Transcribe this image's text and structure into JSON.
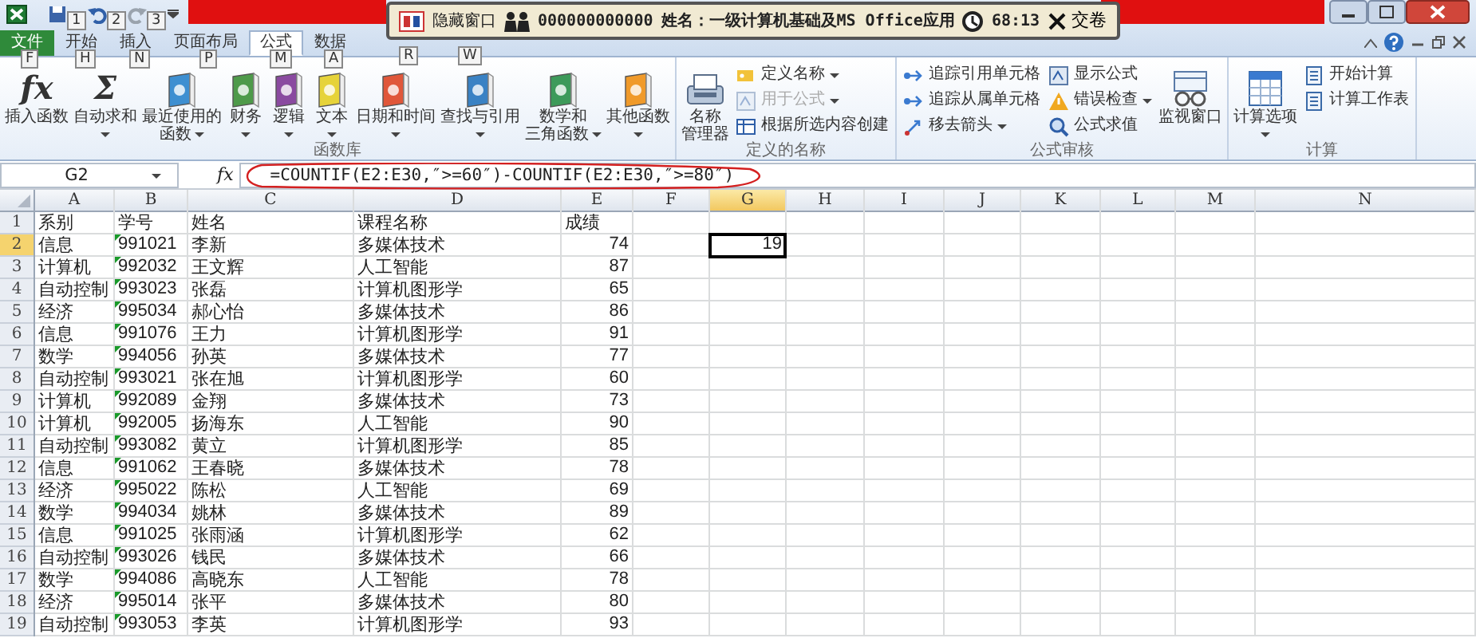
{
  "quick_access": {
    "keytips": [
      "1",
      "2",
      "3"
    ]
  },
  "exam_bar": {
    "hide_button": "隐藏窗口",
    "exam_id": "000000000000",
    "candidate": "姓名：一级计算机基础及MS Office应用",
    "timer": "68:13",
    "submit_button": "交卷"
  },
  "tabs": [
    {
      "label": "文件",
      "keytip": "F",
      "kind": "file",
      "selected": false
    },
    {
      "label": "开始",
      "keytip": "H",
      "kind": "tab",
      "selected": false
    },
    {
      "label": "插入",
      "keytip": "N",
      "kind": "tab",
      "selected": false
    },
    {
      "label": "页面布局",
      "keytip": "P",
      "kind": "tab",
      "selected": false
    },
    {
      "label": "公式",
      "keytip": "M",
      "kind": "tab",
      "selected": true
    },
    {
      "label": "数据",
      "keytip": "A",
      "kind": "tab",
      "selected": false
    }
  ],
  "hidden_tab_keytips": [
    "R",
    "W"
  ],
  "ribbon_groups": [
    {
      "label": "函数库",
      "items": [
        {
          "kind": "glyph",
          "glyph": "fx",
          "lines": [
            "插入函数"
          ],
          "dropdown": false
        },
        {
          "kind": "glyph",
          "glyph": "Σ",
          "lines": [
            "自动求和"
          ],
          "dropdown": true
        },
        {
          "kind": "book",
          "color": "#3d8fd1",
          "lines": [
            "最近使用的",
            "函数"
          ],
          "dropdown": true
        },
        {
          "kind": "book",
          "color": "#4e9a4a",
          "lines": [
            "财务"
          ],
          "dropdown": true
        },
        {
          "kind": "book",
          "color": "#8a4aa0",
          "lines": [
            "逻辑"
          ],
          "dropdown": true
        },
        {
          "kind": "book",
          "color": "#e6d33a",
          "lines": [
            "文本"
          ],
          "dropdown": true
        },
        {
          "kind": "book",
          "color": "#e0573a",
          "lines": [
            "日期和时间"
          ],
          "dropdown": true
        },
        {
          "kind": "book",
          "color": "#3a82c4",
          "lines": [
            "查找与引用"
          ],
          "dropdown": true
        },
        {
          "kind": "book",
          "color": "#3d9a5a",
          "lines": [
            "数学和",
            "三角函数"
          ],
          "dropdown": true
        },
        {
          "kind": "book",
          "color": "#f09a2a",
          "lines": [
            "其他函数"
          ],
          "dropdown": true
        }
      ]
    },
    {
      "label": "定义的名称",
      "items": [
        {
          "kind": "large",
          "lines": [
            "名称",
            "管理器"
          ],
          "dropdown": false
        },
        {
          "kind": "small",
          "label": "定义名称",
          "dropdown": true,
          "disabled": false
        },
        {
          "kind": "small",
          "label": "用于公式",
          "dropdown": true,
          "disabled": true
        },
        {
          "kind": "small",
          "label": "根据所选内容创建",
          "dropdown": false,
          "disabled": false
        }
      ]
    },
    {
      "label": "公式审核",
      "items": [
        {
          "kind": "small",
          "label": "追踪引用单元格",
          "dropdown": false,
          "disabled": false
        },
        {
          "kind": "small",
          "label": "追踪从属单元格",
          "dropdown": false,
          "disabled": false
        },
        {
          "kind": "small",
          "label": "移去箭头",
          "dropdown": true,
          "disabled": false
        },
        {
          "kind": "small",
          "label": "显示公式",
          "dropdown": false,
          "disabled": false
        },
        {
          "kind": "small",
          "label": "错误检查",
          "dropdown": true,
          "disabled": false
        },
        {
          "kind": "small",
          "label": "公式求值",
          "dropdown": false,
          "disabled": false
        },
        {
          "kind": "large",
          "lines": [
            "监视窗口"
          ],
          "dropdown": false
        }
      ]
    },
    {
      "label": "计算",
      "items": [
        {
          "kind": "large",
          "lines": [
            "计算选项"
          ],
          "dropdown": true
        },
        {
          "kind": "small",
          "label": "开始计算",
          "dropdown": false,
          "disabled": false
        },
        {
          "kind": "small",
          "label": "计算工作表",
          "dropdown": false,
          "disabled": false
        }
      ]
    }
  ],
  "formula_bar": {
    "name_box": "G2",
    "function_glyph": "fx",
    "formula": "=COUNTIF(E2:E30,″>=60″)-COUNTIF(E2:E30,″>=80″)"
  },
  "columns": [
    {
      "label": "A",
      "selected": false
    },
    {
      "label": "B",
      "selected": false
    },
    {
      "label": "C",
      "selected": false
    },
    {
      "label": "D",
      "selected": false
    },
    {
      "label": "E",
      "selected": false
    },
    {
      "label": "F",
      "selected": false
    },
    {
      "label": "G",
      "selected": true
    },
    {
      "label": "H",
      "selected": false
    },
    {
      "label": "I",
      "selected": false
    },
    {
      "label": "J",
      "selected": false
    },
    {
      "label": "K",
      "selected": false
    },
    {
      "label": "L",
      "selected": false
    },
    {
      "label": "M",
      "selected": false
    },
    {
      "label": "N",
      "selected": false
    }
  ],
  "rows": [
    {
      "number": "1",
      "selected": false,
      "flagged": false,
      "cells": [
        "系别",
        "学号",
        "姓名",
        "课程名称",
        "成绩"
      ]
    },
    {
      "number": "2",
      "selected": true,
      "flagged": true,
      "cells": [
        "信息",
        "991021",
        "李新",
        "多媒体技术",
        "74"
      ],
      "active_cell": "19"
    },
    {
      "number": "3",
      "selected": false,
      "flagged": true,
      "cells": [
        "计算机",
        "992032",
        "王文辉",
        "人工智能",
        "87"
      ]
    },
    {
      "number": "4",
      "selected": false,
      "flagged": true,
      "cells": [
        "自动控制",
        "993023",
        "张磊",
        "计算机图形学",
        "65"
      ]
    },
    {
      "number": "5",
      "selected": false,
      "flagged": true,
      "cells": [
        "经济",
        "995034",
        "郝心怡",
        "多媒体技术",
        "86"
      ]
    },
    {
      "number": "6",
      "selected": false,
      "flagged": true,
      "cells": [
        "信息",
        "991076",
        "王力",
        "计算机图形学",
        "91"
      ]
    },
    {
      "number": "7",
      "selected": false,
      "flagged": true,
      "cells": [
        "数学",
        "994056",
        "孙英",
        "多媒体技术",
        "77"
      ]
    },
    {
      "number": "8",
      "selected": false,
      "flagged": true,
      "cells": [
        "自动控制",
        "993021",
        "张在旭",
        "计算机图形学",
        "60"
      ]
    },
    {
      "number": "9",
      "selected": false,
      "flagged": true,
      "cells": [
        "计算机",
        "992089",
        "金翔",
        "多媒体技术",
        "73"
      ]
    },
    {
      "number": "10",
      "selected": false,
      "flagged": true,
      "cells": [
        "计算机",
        "992005",
        "扬海东",
        "人工智能",
        "90"
      ]
    },
    {
      "number": "11",
      "selected": false,
      "flagged": true,
      "cells": [
        "自动控制",
        "993082",
        "黄立",
        "计算机图形学",
        "85"
      ]
    },
    {
      "number": "12",
      "selected": false,
      "flagged": true,
      "cells": [
        "信息",
        "991062",
        "王春晓",
        "多媒体技术",
        "78"
      ]
    },
    {
      "number": "13",
      "selected": false,
      "flagged": true,
      "cells": [
        "经济",
        "995022",
        "陈松",
        "人工智能",
        "69"
      ]
    },
    {
      "number": "14",
      "selected": false,
      "flagged": true,
      "cells": [
        "数学",
        "994034",
        "姚林",
        "多媒体技术",
        "89"
      ]
    },
    {
      "number": "15",
      "selected": false,
      "flagged": true,
      "cells": [
        "信息",
        "991025",
        "张雨涵",
        "计算机图形学",
        "62"
      ]
    },
    {
      "number": "16",
      "selected": false,
      "flagged": true,
      "cells": [
        "自动控制",
        "993026",
        "钱民",
        "多媒体技术",
        "66"
      ]
    },
    {
      "number": "17",
      "selected": false,
      "flagged": true,
      "cells": [
        "数学",
        "994086",
        "高晓东",
        "人工智能",
        "78"
      ]
    },
    {
      "number": "18",
      "selected": false,
      "flagged": true,
      "cells": [
        "经济",
        "995014",
        "张平",
        "多媒体技术",
        "80"
      ]
    },
    {
      "number": "19",
      "selected": false,
      "flagged": true,
      "cells": [
        "自动控制",
        "993053",
        "李英",
        "计算机图形学",
        "93"
      ]
    }
  ]
}
